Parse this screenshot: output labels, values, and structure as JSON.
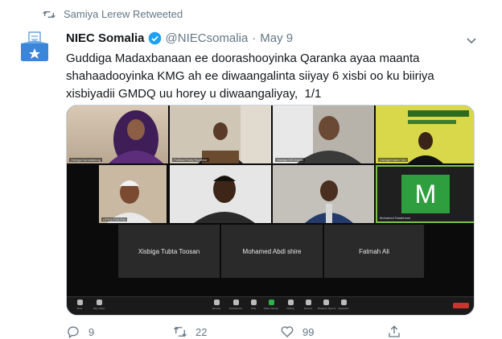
{
  "retweet": {
    "text": "Samiya Lerew Retweeted",
    "icon": "retweet-icon"
  },
  "tweet": {
    "author_name": "NIEC Somalia",
    "handle": "@NIECsomalia",
    "separator": "·",
    "date": "May 9",
    "text": "Guddiga Madaxbanaan ee doorashooyinka Qaranka ayaa maanta shahaadooyinka KMG ah ee diwaangalinta siiyay 6 xisbi oo ku biiriya xisbiyadii GMDQ uu horey u diwaangaliyay,  1/1",
    "verified": true
  },
  "video_call": {
    "tile_labels": [
      "Xisbiga Damuladuug",
      "Political Party Registrar",
      "",
      "Xisbiga XIS Goma",
      "Xisbiga Kaam Yah",
      "UPRS-T-51 Par",
      "",
      "",
      "",
      "Mohamed Sarakhoon"
    ],
    "name_tiles": [
      "Xisbiga Tubta Toosan",
      "Mohamed Abdi shire",
      "Fatmah Ali"
    ],
    "m_tile_letter": "M",
    "toolbar": [
      "Mute",
      "Stop Video",
      "Security",
      "Participants",
      "Chat",
      "Share Screen",
      "Polling",
      "Record",
      "Breakout Rooms",
      "Reactions"
    ]
  },
  "actions": {
    "replies": "9",
    "retweets": "22",
    "likes": "99"
  },
  "colors": {
    "accent": "#1da1f2",
    "muted": "#657786",
    "verified": "#1da1f2",
    "m_green": "#2e9e3f"
  }
}
